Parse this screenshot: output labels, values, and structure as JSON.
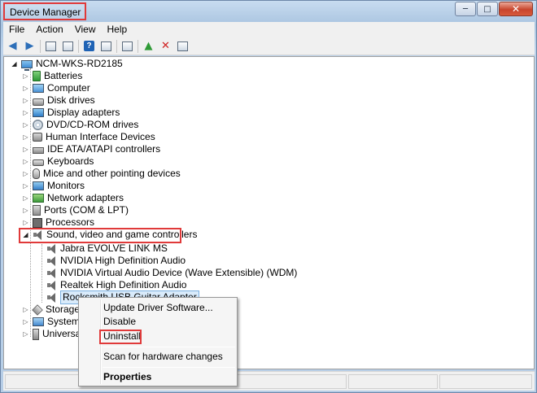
{
  "window": {
    "title": "Device Manager",
    "caption": {
      "minimize": "─",
      "maximize": "□",
      "close": "✕"
    }
  },
  "menu": [
    "File",
    "Action",
    "View",
    "Help"
  ],
  "toolbar": {
    "icons": [
      "back-arrow-icon",
      "forward-arrow-icon",
      "properties-icon",
      "console-tree-icon",
      "help-icon",
      "console-icon",
      "scan-hardware-icon",
      "update-driver-icon",
      "uninstall-icon",
      "disable-icon"
    ],
    "help_glyph": "?"
  },
  "tree": {
    "root": "NCM-WKS-RD2185",
    "categories": [
      {
        "label": "Batteries",
        "icon": "battery"
      },
      {
        "label": "Computer",
        "icon": "computer"
      },
      {
        "label": "Disk drives",
        "icon": "disk"
      },
      {
        "label": "Display adapters",
        "icon": "display"
      },
      {
        "label": "DVD/CD-ROM drives",
        "icon": "dvd"
      },
      {
        "label": "Human Interface Devices",
        "icon": "hid"
      },
      {
        "label": "IDE ATA/ATAPI controllers",
        "icon": "ide"
      },
      {
        "label": "Keyboards",
        "icon": "keyboard"
      },
      {
        "label": "Mice and other pointing devices",
        "icon": "mouse"
      },
      {
        "label": "Monitors",
        "icon": "monitor"
      },
      {
        "label": "Network adapters",
        "icon": "network"
      },
      {
        "label": "Ports (COM & LPT)",
        "icon": "ports"
      },
      {
        "label": "Processors",
        "icon": "cpu"
      },
      {
        "label": "Sound, video and game controllers",
        "icon": "sound"
      }
    ],
    "sound_children": [
      "Jabra EVOLVE LINK MS",
      "NVIDIA High Definition Audio",
      "NVIDIA Virtual Audio Device (Wave Extensible) (WDM)",
      "Realtek High Definition Audio",
      "Rocksmith USB Guitar Adapter"
    ],
    "after": [
      {
        "label": "Storage c",
        "icon": "storage"
      },
      {
        "label": "System d",
        "icon": "system"
      },
      {
        "label": "Universal",
        "icon": "usb"
      }
    ]
  },
  "context_menu": {
    "items": [
      "Update Driver Software...",
      "Disable",
      "Uninstall",
      "Scan for hardware changes",
      "Properties"
    ]
  },
  "colors": {
    "highlight": "#e03a3a",
    "selection": "#d9ebfb"
  }
}
